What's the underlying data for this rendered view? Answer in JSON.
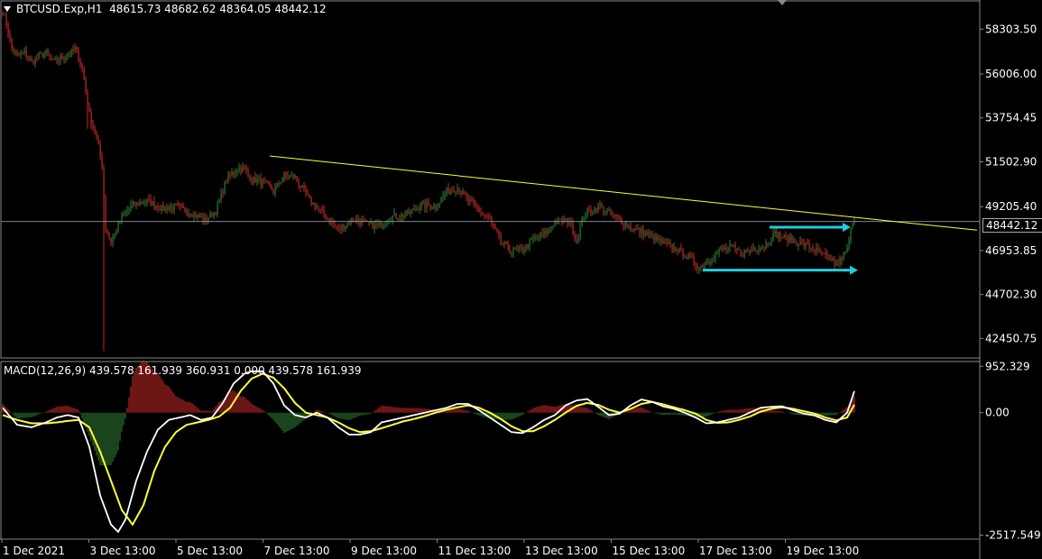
{
  "header": {
    "symbol": "BTCUSD.Exp,H1",
    "ohlc": "48615.73 48682.62 48364.05 48442.12"
  },
  "current_price_label": "48442.12",
  "macd_header": "MACD(12,26,9) 439.578 161.939 360.931 0.000 439.578 161.939",
  "colors": {
    "background": "#000000",
    "bull": "#2e7d32",
    "bear": "#c62828",
    "trendline": "#ffff33",
    "arrow": "#22ccdd",
    "macd_line": "#ffffff",
    "signal_line": "#ffff33",
    "grid": "#888888"
  },
  "chart_data": [
    {
      "type": "candlestick",
      "price_axis_ticks": [
        "58303.50",
        "56006.00",
        "53754.45",
        "51502.90",
        "49205.40",
        "46953.85",
        "44702.30",
        "42450.75"
      ],
      "time_axis_labels": [
        "1 Dec 2021",
        "3 Dec 13:00",
        "5 Dec 13:00",
        "7 Dec 13:00",
        "9 Dec 13:00",
        "11 Dec 13:00",
        "13 Dec 13:00",
        "15 Dec 13:00",
        "17 Dec 13:00",
        "19 Dec 13:00"
      ],
      "ylim": [
        41450,
        59750
      ],
      "last_price": 48442.12,
      "close_path": [
        [
          0,
          59200
        ],
        [
          2,
          58600
        ],
        [
          5,
          57300
        ],
        [
          8,
          56900
        ],
        [
          12,
          57100
        ],
        [
          16,
          56600
        ],
        [
          20,
          56900
        ],
        [
          24,
          57100
        ],
        [
          28,
          56600
        ],
        [
          32,
          56800
        ],
        [
          36,
          56900
        ],
        [
          40,
          57300
        ],
        [
          44,
          56300
        ],
        [
          48,
          53900
        ],
        [
          52,
          52700
        ],
        [
          55,
          51300
        ],
        [
          57,
          48100
        ],
        [
          60,
          47400
        ],
        [
          62,
          47800
        ],
        [
          66,
          48700
        ],
        [
          72,
          49300
        ],
        [
          80,
          49500
        ],
        [
          88,
          49100
        ],
        [
          96,
          49200
        ],
        [
          104,
          48900
        ],
        [
          112,
          48500
        ],
        [
          118,
          49000
        ],
        [
          124,
          50600
        ],
        [
          130,
          51200
        ],
        [
          134,
          51100
        ],
        [
          138,
          50600
        ],
        [
          144,
          50500
        ],
        [
          150,
          50000
        ],
        [
          156,
          50800
        ],
        [
          162,
          50700
        ],
        [
          170,
          49500
        ],
        [
          178,
          48800
        ],
        [
          186,
          48000
        ],
        [
          194,
          48600
        ],
        [
          202,
          48300
        ],
        [
          208,
          48200
        ],
        [
          216,
          48700
        ],
        [
          224,
          48800
        ],
        [
          232,
          49300
        ],
        [
          240,
          49200
        ],
        [
          246,
          50000
        ],
        [
          252,
          50200
        ],
        [
          258,
          49500
        ],
        [
          264,
          49000
        ],
        [
          270,
          48500
        ],
        [
          276,
          47400
        ],
        [
          282,
          46900
        ],
        [
          288,
          47000
        ],
        [
          294,
          47500
        ],
        [
          300,
          47800
        ],
        [
          306,
          48400
        ],
        [
          314,
          48500
        ],
        [
          318,
          47400
        ],
        [
          322,
          48800
        ],
        [
          330,
          49200
        ],
        [
          336,
          48900
        ],
        [
          342,
          48500
        ],
        [
          348,
          48100
        ],
        [
          354,
          47900
        ],
        [
          360,
          47700
        ],
        [
          366,
          47300
        ],
        [
          374,
          47000
        ],
        [
          380,
          46600
        ],
        [
          386,
          46100
        ],
        [
          392,
          46500
        ],
        [
          398,
          47000
        ],
        [
          404,
          47100
        ],
        [
          410,
          46800
        ],
        [
          416,
          47100
        ],
        [
          422,
          47200
        ],
        [
          428,
          47800
        ],
        [
          434,
          47600
        ],
        [
          440,
          47400
        ],
        [
          446,
          47200
        ],
        [
          452,
          46900
        ],
        [
          458,
          46500
        ],
        [
          462,
          46200
        ],
        [
          466,
          46700
        ],
        [
          468,
          47000
        ],
        [
          470,
          48000
        ],
        [
          472,
          48442
        ]
      ],
      "trendline": {
        "from": [
          148,
          51800
        ],
        "to": [
          540,
          48000
        ]
      },
      "arrows": [
        {
          "from": [
            425,
            48150
          ],
          "to": [
            470,
            48150
          ]
        },
        {
          "from": [
            388,
            45950
          ],
          "to": [
            474,
            45950
          ]
        }
      ]
    },
    {
      "type": "macd",
      "params": [
        12,
        26,
        9
      ],
      "ylim": [
        -2600,
        1050
      ],
      "y_ticks": [
        "952.329",
        "0.00",
        "-2517.549"
      ],
      "macd_path": [
        [
          0,
          100
        ],
        [
          8,
          -250
        ],
        [
          16,
          -300
        ],
        [
          24,
          -200
        ],
        [
          30,
          -100
        ],
        [
          36,
          -50
        ],
        [
          42,
          -100
        ],
        [
          48,
          -700
        ],
        [
          54,
          -1700
        ],
        [
          60,
          -2300
        ],
        [
          64,
          -2450
        ],
        [
          68,
          -2200
        ],
        [
          74,
          -1400
        ],
        [
          80,
          -800
        ],
        [
          86,
          -350
        ],
        [
          92,
          -150
        ],
        [
          98,
          -100
        ],
        [
          104,
          -50
        ],
        [
          110,
          -150
        ],
        [
          116,
          -100
        ],
        [
          122,
          200
        ],
        [
          128,
          600
        ],
        [
          134,
          800
        ],
        [
          138,
          850
        ],
        [
          144,
          850
        ],
        [
          150,
          600
        ],
        [
          156,
          150
        ],
        [
          162,
          -50
        ],
        [
          168,
          -100
        ],
        [
          174,
          0
        ],
        [
          180,
          -100
        ],
        [
          186,
          -300
        ],
        [
          192,
          -450
        ],
        [
          198,
          -450
        ],
        [
          204,
          -400
        ],
        [
          210,
          -200
        ],
        [
          216,
          -150
        ],
        [
          222,
          -100
        ],
        [
          228,
          -50
        ],
        [
          234,
          0
        ],
        [
          240,
          50
        ],
        [
          246,
          100
        ],
        [
          252,
          180
        ],
        [
          258,
          180
        ],
        [
          264,
          50
        ],
        [
          270,
          -100
        ],
        [
          276,
          -250
        ],
        [
          282,
          -400
        ],
        [
          288,
          -420
        ],
        [
          294,
          -300
        ],
        [
          300,
          -150
        ],
        [
          306,
          -50
        ],
        [
          312,
          150
        ],
        [
          318,
          250
        ],
        [
          324,
          280
        ],
        [
          330,
          120
        ],
        [
          336,
          -50
        ],
        [
          342,
          -20
        ],
        [
          348,
          150
        ],
        [
          354,
          270
        ],
        [
          360,
          220
        ],
        [
          366,
          130
        ],
        [
          372,
          80
        ],
        [
          378,
          0
        ],
        [
          384,
          -100
        ],
        [
          390,
          -220
        ],
        [
          396,
          -200
        ],
        [
          402,
          -150
        ],
        [
          408,
          -100
        ],
        [
          414,
          0
        ],
        [
          420,
          100
        ],
        [
          426,
          120
        ],
        [
          432,
          130
        ],
        [
          438,
          50
        ],
        [
          444,
          -20
        ],
        [
          450,
          -60
        ],
        [
          456,
          -150
        ],
        [
          462,
          -200
        ],
        [
          468,
          0
        ],
        [
          472,
          440
        ]
      ],
      "signal_path": [
        [
          0,
          -50
        ],
        [
          8,
          -150
        ],
        [
          16,
          -220
        ],
        [
          24,
          -220
        ],
        [
          30,
          -200
        ],
        [
          36,
          -170
        ],
        [
          42,
          -150
        ],
        [
          48,
          -300
        ],
        [
          54,
          -800
        ],
        [
          60,
          -1400
        ],
        [
          66,
          -2000
        ],
        [
          72,
          -2300
        ],
        [
          78,
          -1900
        ],
        [
          84,
          -1200
        ],
        [
          90,
          -700
        ],
        [
          96,
          -400
        ],
        [
          102,
          -250
        ],
        [
          108,
          -200
        ],
        [
          114,
          -150
        ],
        [
          120,
          -80
        ],
        [
          126,
          100
        ],
        [
          132,
          450
        ],
        [
          138,
          700
        ],
        [
          144,
          800
        ],
        [
          150,
          720
        ],
        [
          156,
          500
        ],
        [
          162,
          200
        ],
        [
          168,
          0
        ],
        [
          174,
          -50
        ],
        [
          180,
          -100
        ],
        [
          186,
          -200
        ],
        [
          192,
          -320
        ],
        [
          198,
          -400
        ],
        [
          204,
          -380
        ],
        [
          210,
          -320
        ],
        [
          216,
          -250
        ],
        [
          222,
          -180
        ],
        [
          228,
          -130
        ],
        [
          234,
          -70
        ],
        [
          240,
          0
        ],
        [
          246,
          60
        ],
        [
          252,
          110
        ],
        [
          258,
          150
        ],
        [
          264,
          100
        ],
        [
          270,
          0
        ],
        [
          276,
          -130
        ],
        [
          282,
          -280
        ],
        [
          288,
          -380
        ],
        [
          294,
          -380
        ],
        [
          300,
          -280
        ],
        [
          306,
          -150
        ],
        [
          312,
          0
        ],
        [
          318,
          140
        ],
        [
          324,
          200
        ],
        [
          330,
          160
        ],
        [
          336,
          60
        ],
        [
          342,
          0
        ],
        [
          348,
          80
        ],
        [
          354,
          180
        ],
        [
          360,
          220
        ],
        [
          366,
          170
        ],
        [
          372,
          110
        ],
        [
          378,
          50
        ],
        [
          384,
          -20
        ],
        [
          390,
          -150
        ],
        [
          396,
          -210
        ],
        [
          402,
          -200
        ],
        [
          408,
          -150
        ],
        [
          414,
          -80
        ],
        [
          420,
          20
        ],
        [
          426,
          80
        ],
        [
          432,
          110
        ],
        [
          438,
          80
        ],
        [
          444,
          30
        ],
        [
          450,
          -20
        ],
        [
          456,
          -100
        ],
        [
          462,
          -160
        ],
        [
          468,
          -100
        ],
        [
          472,
          162
        ]
      ]
    }
  ]
}
